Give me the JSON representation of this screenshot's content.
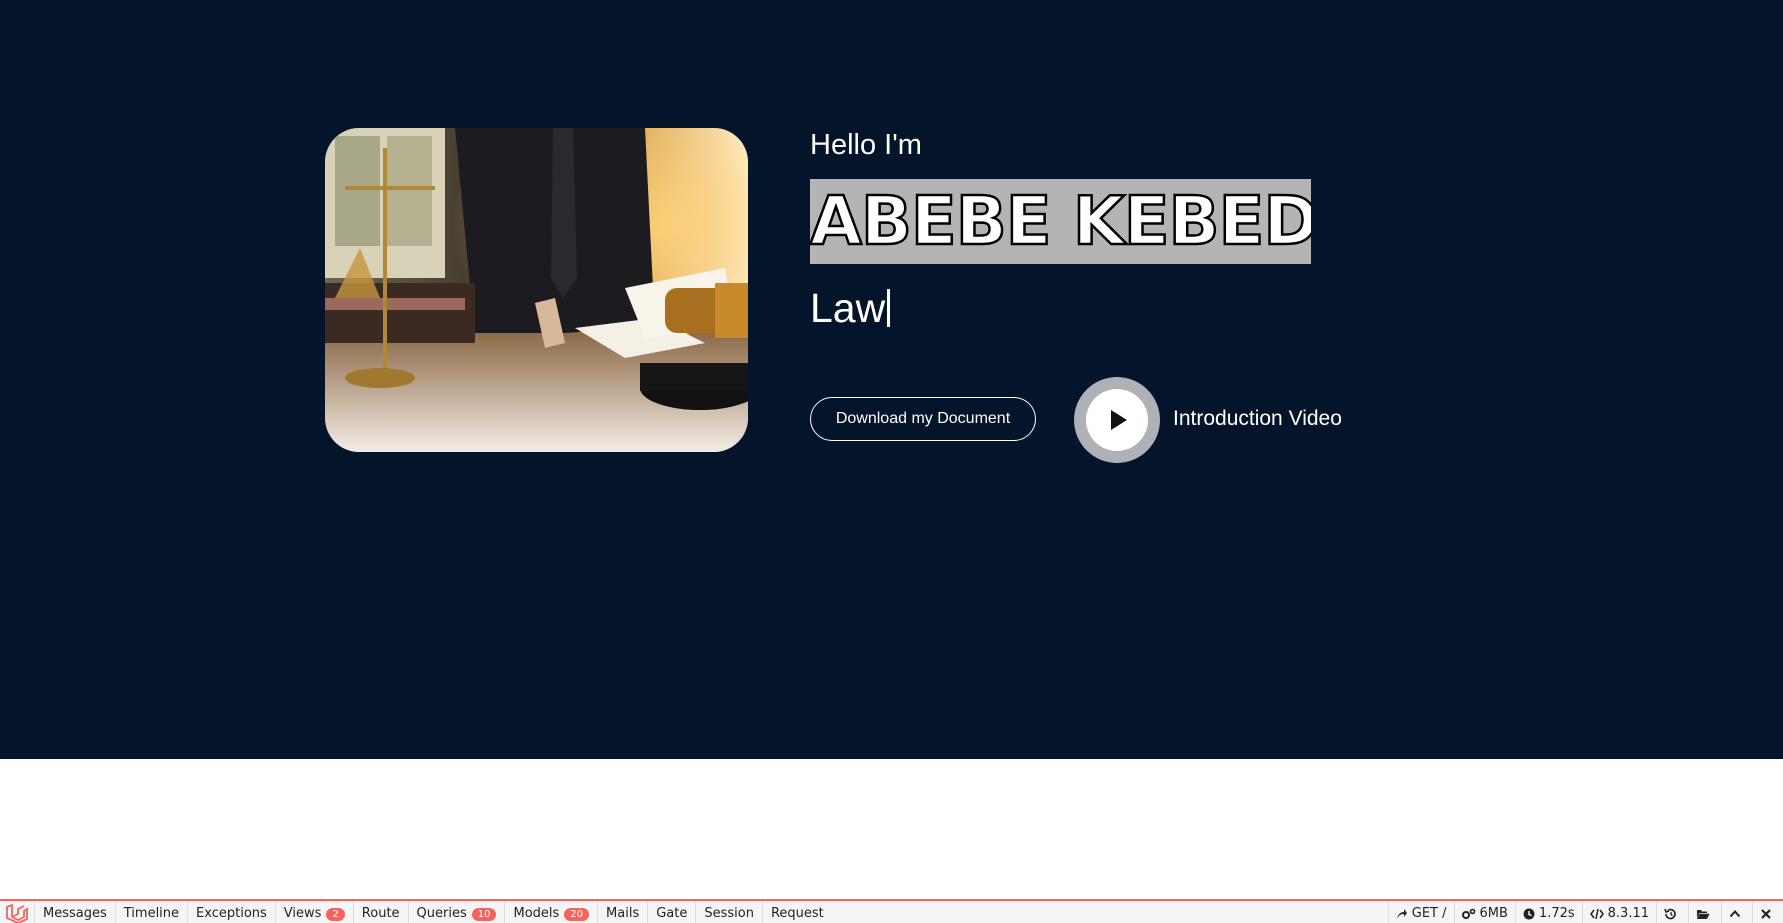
{
  "hero": {
    "greeting": "Hello I'm",
    "name": "ABEBE KEBEDE",
    "role": "Law",
    "download_label": "Download my Document",
    "video_label": "Introduction Video",
    "background_color": "#04142a"
  },
  "debugbar": {
    "tabs": [
      {
        "label": "Messages"
      },
      {
        "label": "Timeline"
      },
      {
        "label": "Exceptions"
      },
      {
        "label": "Views",
        "badge": "2"
      },
      {
        "label": "Route"
      },
      {
        "label": "Queries",
        "badge": "10"
      },
      {
        "label": "Models",
        "badge": "20"
      },
      {
        "label": "Mails"
      },
      {
        "label": "Gate"
      },
      {
        "label": "Session"
      },
      {
        "label": "Request"
      }
    ],
    "method": "GET /",
    "memory": "6MB",
    "time": "1.72s",
    "php_version": "8.3.11",
    "accent_color": "#f4645f"
  }
}
